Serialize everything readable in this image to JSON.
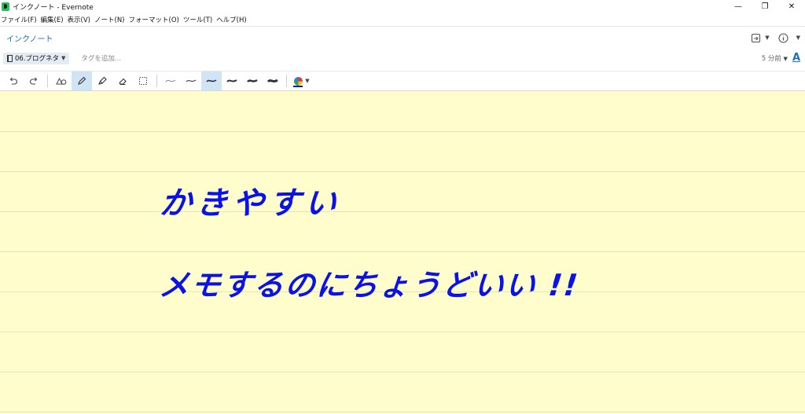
{
  "window": {
    "title": "インクノート - Evernote",
    "controls": {
      "minimize": "—",
      "restore": "❐",
      "close": "✕"
    }
  },
  "menubar": {
    "items": [
      "ファイル(F)",
      "編集(E)",
      "表示(V)",
      "ノート(N)",
      "フォーマット(O)",
      "ツール(T)",
      "ヘルプ(H)"
    ]
  },
  "note": {
    "title": "インクノート",
    "notebook": "06.ブログネタ",
    "tag_placeholder": "タグを追加...",
    "modified": "5 分前",
    "font_button": "A"
  },
  "toolbar": {
    "tools": [
      "undo-icon",
      "redo-icon",
      "shapes-icon",
      "pen-icon",
      "highlighter-icon",
      "eraser-icon",
      "lasso-select-icon"
    ],
    "active_tool": "pen-icon",
    "stroke_widths": [
      "1",
      "2",
      "3",
      "4",
      "5",
      "6"
    ],
    "active_stroke": "3",
    "ink_color": "#0b12e6"
  },
  "canvas": {
    "background": "#fffdcc",
    "handwriting": {
      "line1": "かきやすい",
      "line2": "メモするのにちょうどいい !!"
    }
  }
}
